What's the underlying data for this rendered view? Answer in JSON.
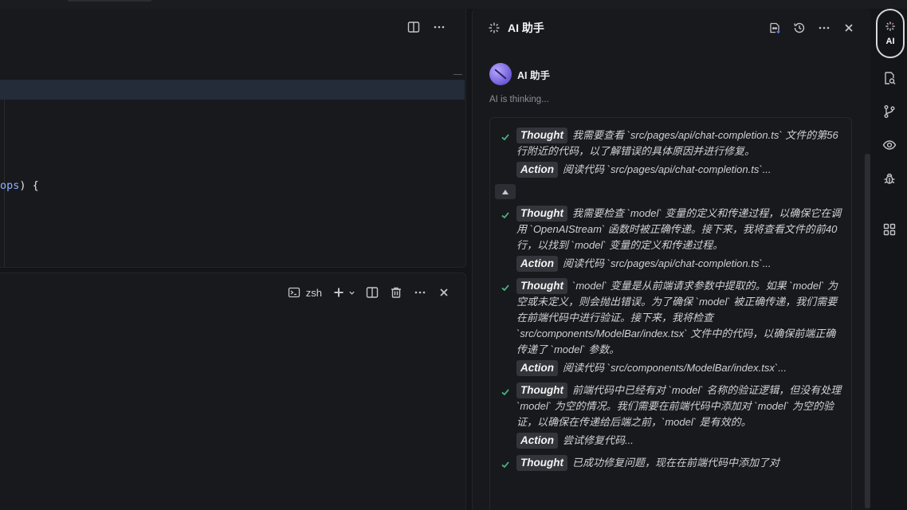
{
  "editor": {
    "code_prefix": "",
    "code_token": "ops",
    "code_suffix": ") {"
  },
  "terminal": {
    "shell_label": "zsh"
  },
  "ai_panel": {
    "title": "AI 助手",
    "author": "AI 助手",
    "status": "AI is thinking...",
    "steps": [
      {
        "thought_label": "Thought",
        "thought": "我需要查看 `src/pages/api/chat-completion.ts` 文件的第56行附近的代码，以了解错误的具体原因并进行修复。",
        "action_label": "Action",
        "action": "阅读代码 `src/pages/api/chat-completion.ts`..."
      },
      {
        "thought_label": "Thought",
        "thought": "我需要检查 `model` 变量的定义和传递过程，以确保它在调用 `OpenAIStream` 函数时被正确传递。接下来，我将查看文件的前40行，以找到 `model` 变量的定义和传递过程。",
        "action_label": "Action",
        "action": "阅读代码 `src/pages/api/chat-completion.ts`..."
      },
      {
        "thought_label": "Thought",
        "thought": "`model` 变量是从前端请求参数中提取的。如果 `model` 为空或未定义，则会抛出错误。为了确保 `model` 被正确传递，我们需要在前端代码中进行验证。接下来，我将检查 `src/components/ModelBar/index.tsx` 文件中的代码，以确保前端正确传递了 `model` 参数。",
        "action_label": "Action",
        "action": "阅读代码 `src/components/ModelBar/index.tsx`..."
      },
      {
        "thought_label": "Thought",
        "thought": "前端代码中已经有对 `model` 名称的验证逻辑，但没有处理 `model` 为空的情况。我们需要在前端代码中添加对 `model` 为空的验证，以确保在传递给后端之前，`model` 是有效的。",
        "action_label": "Action",
        "action": "尝试修复代码..."
      },
      {
        "thought_label": "Thought",
        "thought": "已成功修复问题，现在在前端代码中添加了对",
        "action_label": "",
        "action": ""
      }
    ]
  },
  "activity_bar": {
    "ai_label": "AI"
  },
  "colors": {
    "background": "#141519",
    "panel": "#18191d",
    "check_green": "#4caf7d",
    "badge_bg": "#34353a",
    "highlight_line": "#232c38"
  }
}
